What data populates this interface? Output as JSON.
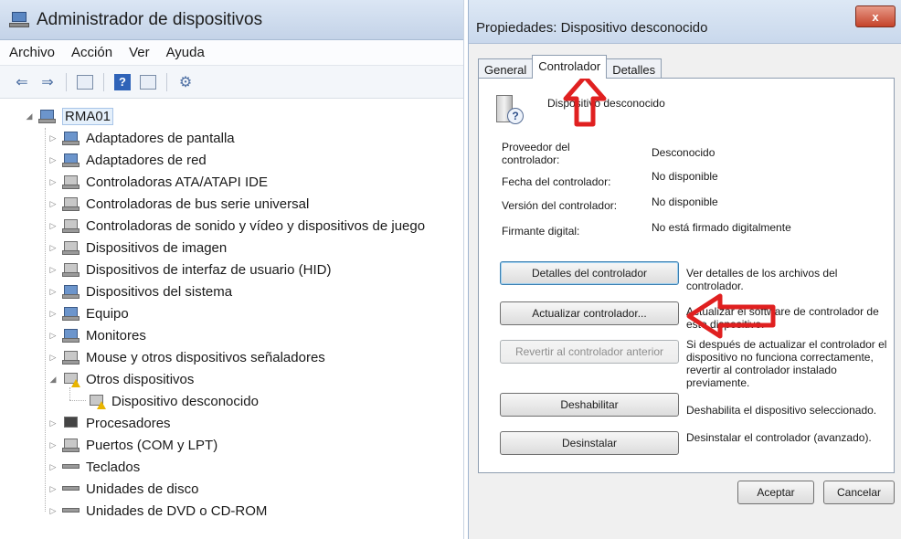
{
  "device_manager": {
    "title": "Administrador de dispositivos",
    "menu": [
      "Archivo",
      "Acción",
      "Ver",
      "Ayuda"
    ],
    "tree": {
      "root": "RMA01",
      "categories": [
        "Adaptadores de pantalla",
        "Adaptadores de red",
        "Controladoras ATA/ATAPI IDE",
        "Controladoras de bus serie universal",
        "Controladoras de sonido y vídeo y dispositivos de juego",
        "Dispositivos de imagen",
        "Dispositivos de interfaz de usuario (HID)",
        "Dispositivos del sistema",
        "Equipo",
        "Monitores",
        "Mouse y otros dispositivos señaladores",
        "Otros dispositivos",
        "Dispositivo desconocido",
        "Procesadores",
        "Puertos (COM y LPT)",
        "Teclados",
        "Unidades de disco",
        "Unidades de DVD o CD-ROM"
      ]
    }
  },
  "properties": {
    "title": "Propiedades: Dispositivo desconocido",
    "close_label": "x",
    "tabs": [
      "General",
      "Controlador",
      "Detalles"
    ],
    "device_name": "Dispositivo desconocido",
    "fields": {
      "provider_label": "Proveedor del controlador:",
      "provider_value": "Desconocido",
      "date_label": "Fecha del controlador:",
      "date_value": "No disponible",
      "version_label": "Versión del controlador:",
      "version_value": "No disponible",
      "signer_label": "Firmante digital:",
      "signer_value": "No está firmado digitalmente"
    },
    "buttons": {
      "details": "Detalles del controlador",
      "details_desc": "Ver detalles de los archivos del controlador.",
      "update": "Actualizar controlador...",
      "update_desc": "Actualizar el software de controlador de este dispositivo.",
      "rollback": "Revertir al controlador anterior",
      "rollback_desc": "Si después de actualizar el controlador el dispositivo no funciona correctamente, revertir al controlador instalado previamente.",
      "disable": "Deshabilitar",
      "disable_desc": "Deshabilita el dispositivo seleccionado.",
      "uninstall": "Desinstalar",
      "uninstall_desc": "Desinstalar el controlador (avanzado)."
    },
    "footer": {
      "ok": "Aceptar",
      "cancel": "Cancelar"
    }
  },
  "colors": {
    "annotation_red": "#e02020",
    "selection": "#e5f0fb"
  }
}
